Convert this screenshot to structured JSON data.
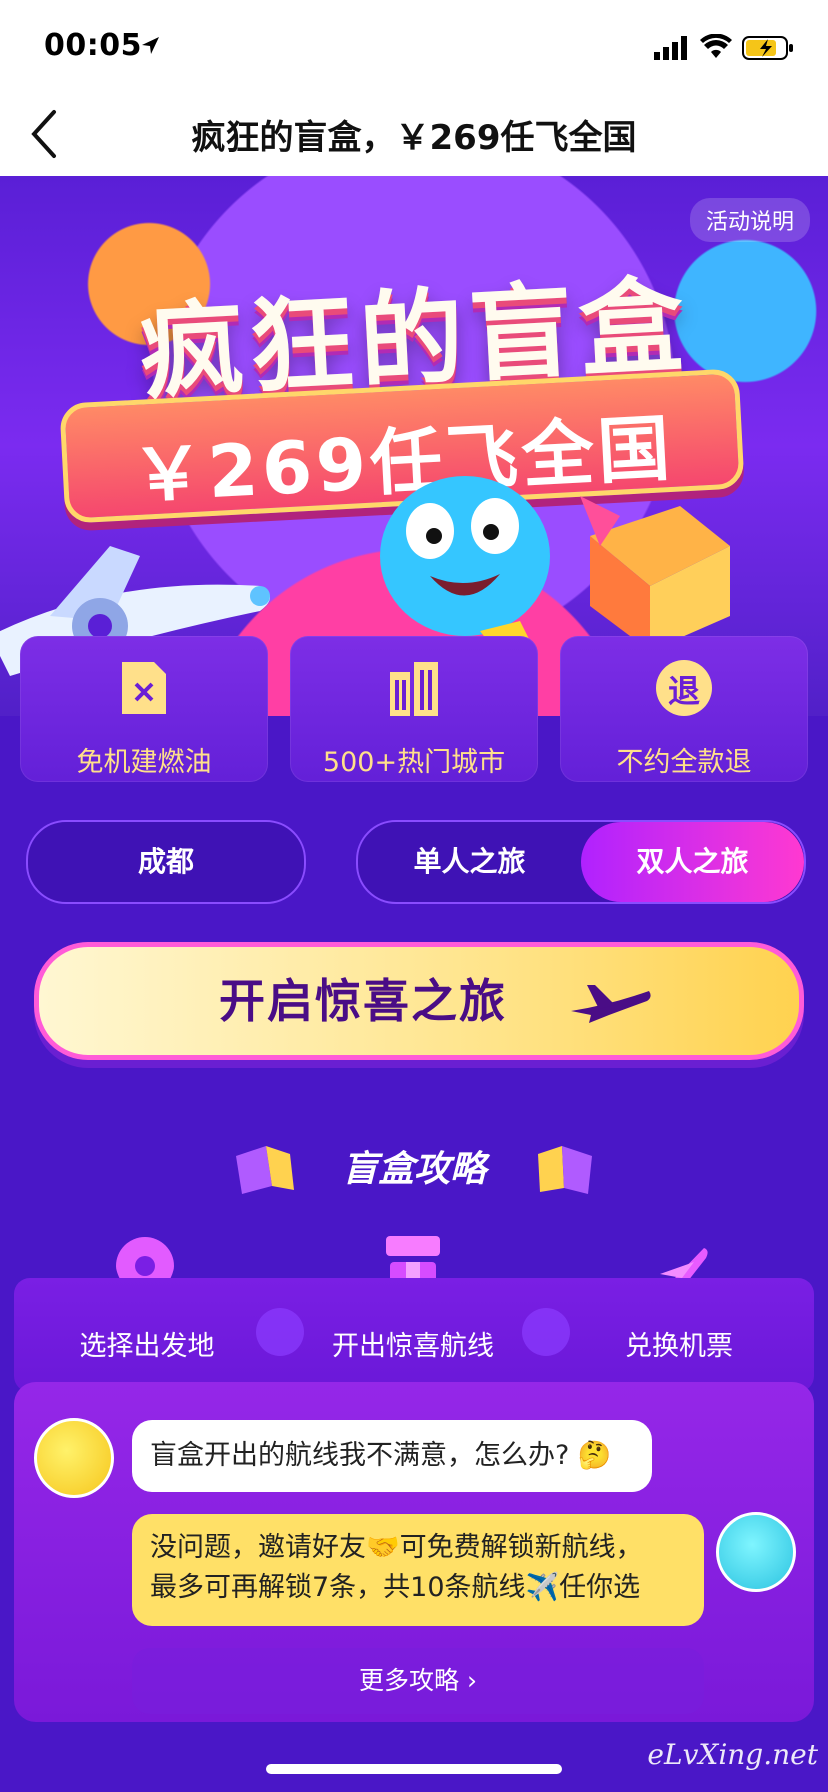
{
  "status_bar": {
    "time": "00:05"
  },
  "nav": {
    "title": "疯狂的盲盒，￥269任飞全国"
  },
  "hero": {
    "rules_link": "活动说明",
    "title": "疯狂的盲盒",
    "subtitle": "￥269任飞全国"
  },
  "features": [
    {
      "label": "免机建燃油",
      "icon": "fuel-ticket-icon"
    },
    {
      "label": "500+热门城市",
      "icon": "buildings-icon"
    },
    {
      "label": "不约全款退",
      "icon": "refund-icon",
      "icon_text": "退"
    }
  ],
  "selectors": {
    "city": "成都",
    "trip_single": "单人之旅",
    "trip_double": "双人之旅",
    "selected_trip": "双人之旅"
  },
  "cta": {
    "label": "开启惊喜之旅"
  },
  "strategy": {
    "title": "盲盒攻略",
    "steps": [
      {
        "label": "选择出发地",
        "icon": "location-pin-icon"
      },
      {
        "label": "开出惊喜航线",
        "icon": "blind-box-icon"
      },
      {
        "label": "兑换机票",
        "icon": "plane-icon"
      }
    ]
  },
  "chat": {
    "question": "盲盒开出的航线我不满意，怎么办? 🤔",
    "answer_line1": "没问题，邀请好友🤝可免费解锁新航线，",
    "answer_line2": "最多可再解锁7条，共10条航线✈️任你选",
    "more_link": "更多攻略 ›"
  },
  "watermark": "eLvXing.net",
  "colors": {
    "accent_pink": "#ff39d1",
    "cta_yellow": "#ffe48a",
    "feature_text": "#ffe08a",
    "page_bg": "#4a17c7"
  }
}
